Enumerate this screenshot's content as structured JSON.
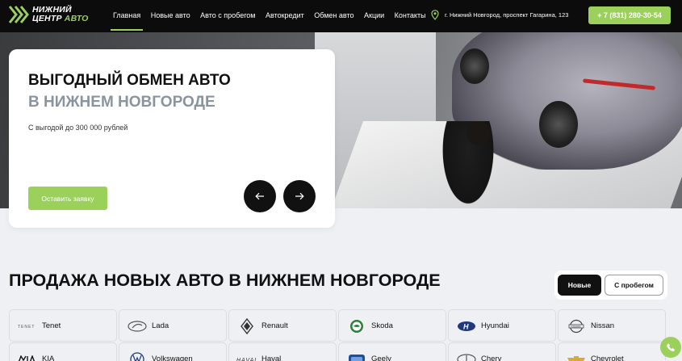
{
  "header": {
    "logo_line1": "НИЖНИЙ",
    "logo_line2_a": "ЦЕНТР",
    "logo_line2_b": "АВТО",
    "nav": [
      {
        "label": "Главная",
        "active": true
      },
      {
        "label": "Новые авто"
      },
      {
        "label": "Авто с пробегом"
      },
      {
        "label": "Автокредит"
      },
      {
        "label": "Обмен авто"
      },
      {
        "label": "Акции"
      },
      {
        "label": "Контакты"
      }
    ],
    "address": "г. Нижний Новгород, проспект Гагарина, 123",
    "phone": "+ 7 (831) 280-30-54"
  },
  "hero": {
    "title_line1": "ВЫГОДНЫЙ ОБМЕН АВТО",
    "title_line2": "В НИЖНЕМ НОВГОРОДЕ",
    "subtitle": "С выгодой до 300 000 рублей",
    "cta": "Оставить заявку",
    "prev_icon": "arrow-left-icon",
    "next_icon": "arrow-right-icon"
  },
  "section": {
    "title": "ПРОДАЖА НОВЫХ АВТО В НИЖНЕМ НОВГОРОДЕ",
    "toggle_new": "Новые",
    "toggle_used": "С пробегом"
  },
  "brands": [
    {
      "name": "Tenet",
      "icon": "tenet-logo-icon"
    },
    {
      "name": "Lada",
      "icon": "lada-logo-icon"
    },
    {
      "name": "Renault",
      "icon": "renault-logo-icon"
    },
    {
      "name": "Skoda",
      "icon": "skoda-logo-icon"
    },
    {
      "name": "Hyundai",
      "icon": "hyundai-logo-icon"
    },
    {
      "name": "Nissan",
      "icon": "nissan-logo-icon"
    },
    {
      "name": "KIA",
      "icon": "kia-logo-icon"
    },
    {
      "name": "Volkswagen",
      "icon": "volkswagen-logo-icon"
    },
    {
      "name": "Haval",
      "icon": "haval-logo-icon"
    },
    {
      "name": "Geely",
      "icon": "geely-logo-icon"
    },
    {
      "name": "Chery",
      "icon": "chery-logo-icon"
    },
    {
      "name": "Chevrolet",
      "icon": "chevrolet-logo-icon"
    }
  ],
  "colors": {
    "accent": "#9bd05a",
    "header_bg": "#0c0c0c",
    "page_bg": "#eef0f3",
    "title_gray": "#8a949e"
  },
  "chat_icon": "phone-icon"
}
